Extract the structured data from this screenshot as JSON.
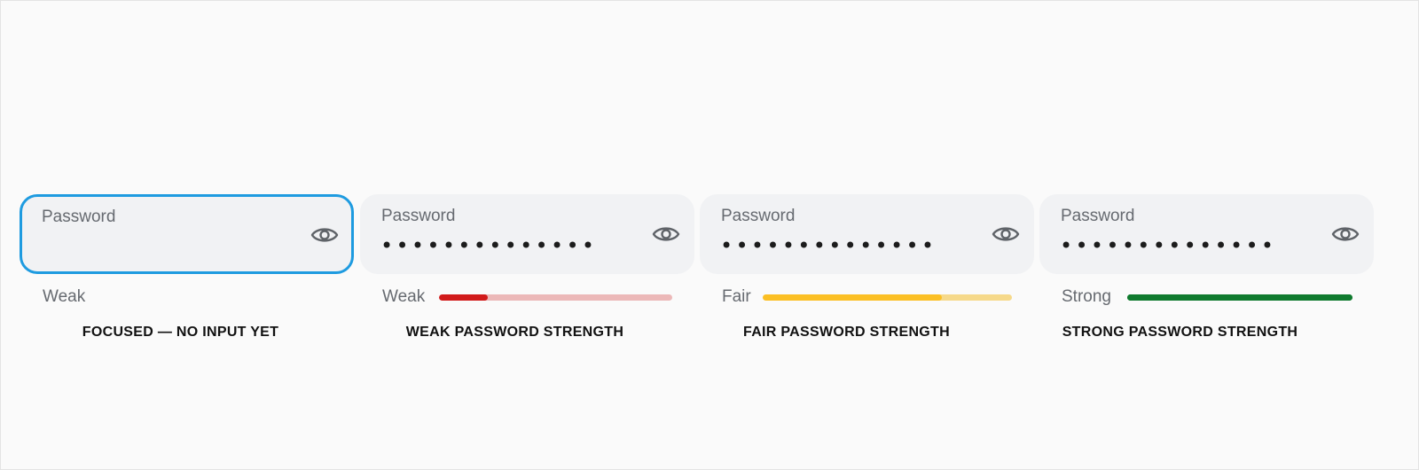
{
  "states": [
    {
      "field_label": "Password",
      "value": "",
      "focused": true,
      "strength_label": "Weak",
      "strength_fraction": 0,
      "show_bar": false,
      "caption": "FOCUSED — NO INPUT YET"
    },
    {
      "field_label": "Password",
      "value": "••••••••••••••",
      "focused": false,
      "strength_label": "Weak",
      "strength_fraction": 0.21,
      "show_bar": true,
      "bar_color": "#d11a1a",
      "track_color": "#ecb8b8",
      "caption": "WEAK PASSWORD STRENGTH"
    },
    {
      "field_label": "Password",
      "value": "••••••••••••••",
      "focused": false,
      "strength_label": "Fair",
      "strength_fraction": 0.72,
      "show_bar": true,
      "bar_color": "#fbbf24",
      "track_color": "#f6d98a",
      "caption": "FAIR PASSWORD STRENGTH"
    },
    {
      "field_label": "Password",
      "value": "••••••••••••••",
      "focused": false,
      "strength_label": "Strong",
      "strength_fraction": 1,
      "show_bar": true,
      "bar_color": "#0f7a2e",
      "track_color": "#0f7a2e",
      "caption": "STRONG PASSWORD STRENGTH"
    }
  ],
  "icons": {
    "visibility_toggle": "eye-icon"
  },
  "colors": {
    "focus_ring": "#1e9be0",
    "field_bg": "#f1f2f4"
  }
}
